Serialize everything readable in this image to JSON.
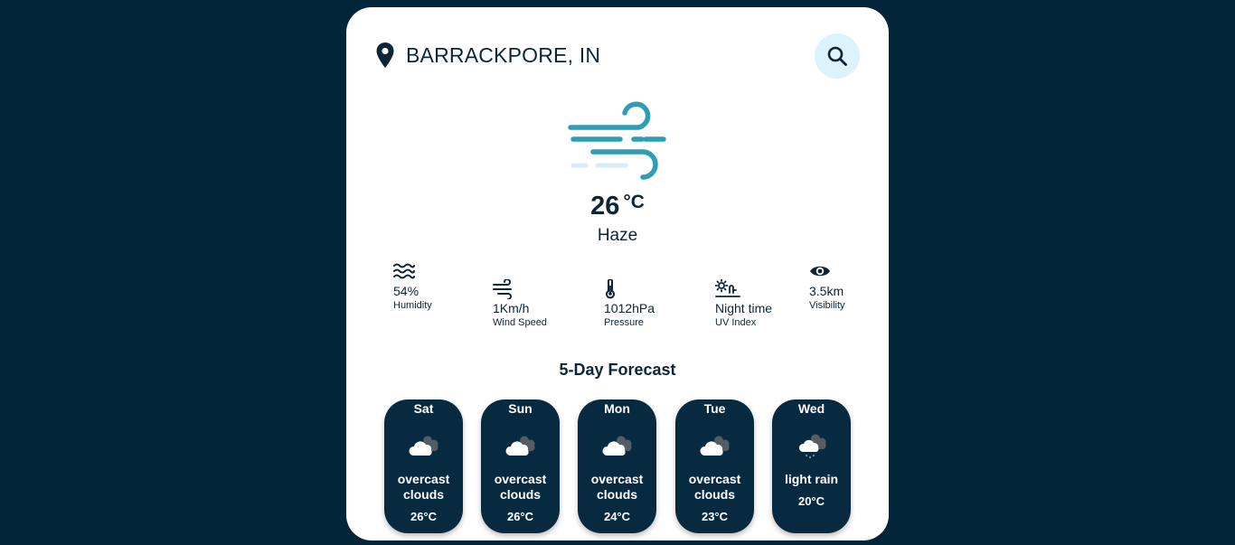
{
  "location": {
    "city": "BARRACKPORE, IN",
    "icon": "map-pin-icon"
  },
  "search": {
    "icon": "search-icon"
  },
  "current": {
    "icon": "wind-icon",
    "temp": "26",
    "unit": "°C",
    "condition": "Haze"
  },
  "stats": [
    {
      "id": "humidity",
      "value": "54%",
      "label": "Humidity",
      "icon": "water-waves-icon"
    },
    {
      "id": "wind",
      "value": "1Km/h",
      "label": "Wind Speed",
      "icon": "wind-icon"
    },
    {
      "id": "pressure",
      "value": "1012hPa",
      "label": "Pressure",
      "icon": "thermometer-icon"
    },
    {
      "id": "uv",
      "value": "Night time",
      "label": "UV Index",
      "icon": "sun-horizon-icon"
    },
    {
      "id": "visibility",
      "value": "3.5km",
      "label": "Visibility",
      "icon": "eye-icon"
    }
  ],
  "forecast": {
    "title": "5-Day Forecast",
    "days": [
      {
        "day": "Sat",
        "desc": "overcast clouds",
        "temp": "26°C",
        "icon": "overcast-cloud-icon"
      },
      {
        "day": "Sun",
        "desc": "overcast clouds",
        "temp": "26°C",
        "icon": "overcast-cloud-icon"
      },
      {
        "day": "Mon",
        "desc": "overcast clouds",
        "temp": "24°C",
        "icon": "overcast-cloud-icon"
      },
      {
        "day": "Tue",
        "desc": "overcast clouds",
        "temp": "23°C",
        "icon": "overcast-cloud-icon"
      },
      {
        "day": "Wed",
        "desc": "light rain",
        "temp": "20°C",
        "icon": "rain-cloud-icon"
      }
    ]
  },
  "colors": {
    "background": "#02253a",
    "card": "#ffffff",
    "text": "#0c2538",
    "accent": "#2e9db5",
    "day_card": "#082a40",
    "search_bg": "#ddf3fc"
  }
}
